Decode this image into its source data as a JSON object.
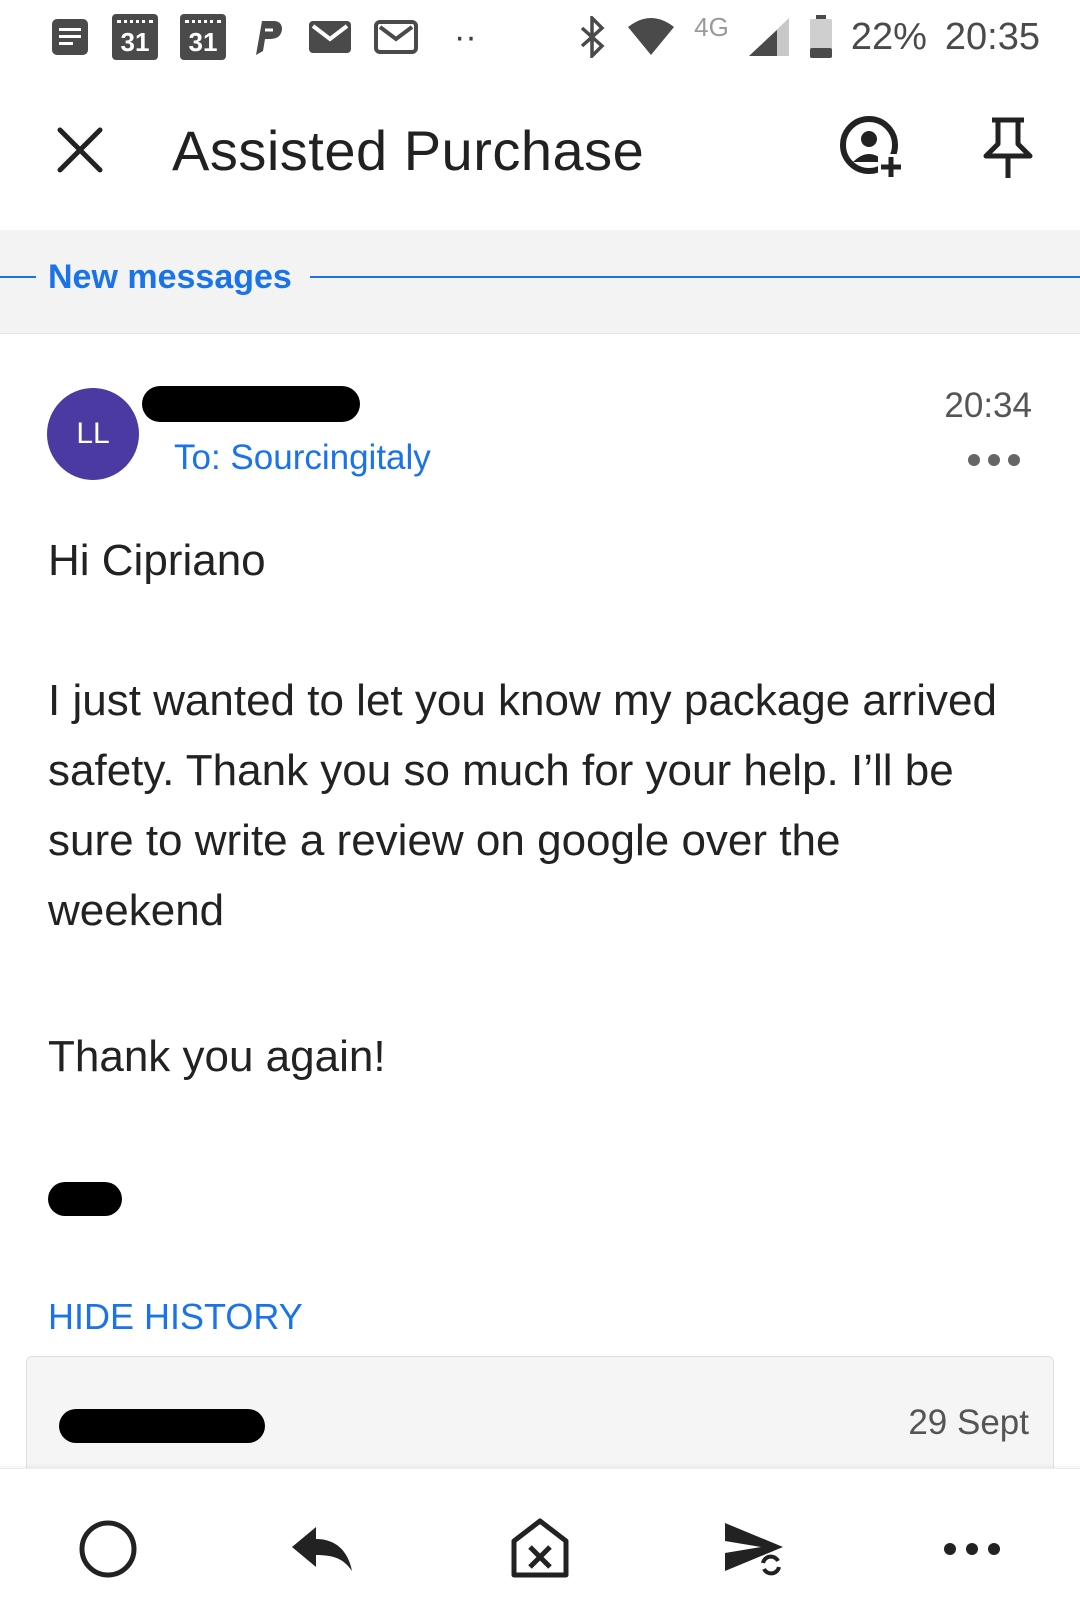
{
  "status_bar": {
    "calendar_day_1": "31",
    "calendar_day_2": "31",
    "overflow": "··",
    "network": "4G",
    "battery": "22%",
    "time": "20:35",
    "icons": [
      "notes-icon",
      "calendar-icon",
      "calendar-icon",
      "paypal-icon",
      "mail-icon",
      "mail-icon",
      "bluetooth-icon",
      "wifi-icon",
      "signal-icon",
      "battery-icon"
    ]
  },
  "toolbar": {
    "title": "Assisted Purchase",
    "icons": [
      "close-icon",
      "add-contact-icon",
      "pin-icon"
    ]
  },
  "new_messages_label": "New messages",
  "message": {
    "avatar_initials": "LL",
    "avatar_color": "#4a3aa1",
    "to": "To: Sourcingitaly",
    "time": "20:34",
    "greeting": "Hi Cipriano",
    "body": "I just wanted to let you know my package arrived safety. Thank you so much for your help. I’ll be sure to write a review on google over the weekend",
    "closing": "Thank you again!"
  },
  "hide_history_label": "HIDE HISTORY",
  "history": {
    "date": "29 Sept"
  },
  "bottom_bar": {
    "icons": [
      "done-circle-icon",
      "reply-icon",
      "delete-message-icon",
      "forward-send-icon",
      "more-icon"
    ]
  },
  "colors": {
    "accent": "#1a73e8",
    "text": "#222222",
    "band_bg": "#f3f3f3"
  }
}
